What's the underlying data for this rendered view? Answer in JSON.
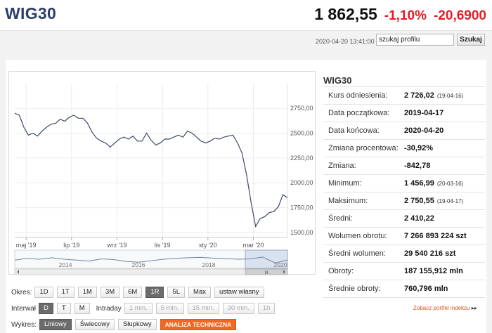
{
  "header": {
    "index_name": "WIG30",
    "value": "1 862,55",
    "change_pct": "-1,10%",
    "change_abs": "-20,6900"
  },
  "searchbar": {
    "timestamp": "2020-04-20 13:41:00",
    "search_value": "szukaj profilu",
    "search_button": "Szukaj"
  },
  "chart_data": {
    "type": "line",
    "title": "",
    "y_ticks": [
      "2750,00",
      "2500,00",
      "2250,00",
      "2000,00",
      "1750,00",
      "1500,00"
    ],
    "y_tick_values": [
      2750,
      2500,
      2250,
      2000,
      1750,
      1500
    ],
    "ylim": [
      1450,
      2850
    ],
    "x_ticks": [
      "maj '19",
      "lip '19",
      "wrz '19",
      "lis '19",
      "sty '20",
      "mar '20"
    ],
    "x_tick_positions": [
      0.5,
      2.5,
      4.5,
      6.5,
      8.5,
      10.5
    ],
    "xlim": [
      0,
      12
    ],
    "grid": true,
    "series": [
      {
        "x": [
          0,
          0.2,
          0.4,
          0.6,
          0.8,
          1.0,
          1.2,
          1.4,
          1.6,
          1.8,
          2.0,
          2.2,
          2.4,
          2.6,
          2.8,
          3.0,
          3.2,
          3.4,
          3.6,
          3.8,
          4.0,
          4.2,
          4.4,
          4.6,
          4.8,
          5.0,
          5.2,
          5.4,
          5.6,
          5.8,
          6.0,
          6.2,
          6.4,
          6.6,
          6.8,
          7.0,
          7.2,
          7.4,
          7.6,
          7.8,
          8.0,
          8.2,
          8.4,
          8.6,
          8.8,
          9.0,
          9.2,
          9.4,
          9.6,
          9.8,
          10.0,
          10.2,
          10.4,
          10.6,
          10.8,
          11.0,
          11.2,
          11.4,
          11.6,
          11.8,
          12.0
        ],
        "values": [
          2700,
          2680,
          2560,
          2480,
          2500,
          2470,
          2520,
          2560,
          2590,
          2600,
          2640,
          2620,
          2660,
          2680,
          2650,
          2650,
          2600,
          2510,
          2450,
          2420,
          2400,
          2360,
          2400,
          2440,
          2460,
          2440,
          2470,
          2420,
          2420,
          2500,
          2430,
          2380,
          2400,
          2440,
          2440,
          2460,
          2480,
          2460,
          2520,
          2500,
          2460,
          2420,
          2400,
          2420,
          2450,
          2440,
          2460,
          2470,
          2480,
          2400,
          2300,
          2080,
          1800,
          1560,
          1640,
          1660,
          1700,
          1710,
          1760,
          1880,
          1850
        ]
      }
    ]
  },
  "navigator": {
    "years": [
      "2014",
      "2016",
      "2018",
      "2020"
    ],
    "scroll_thumb": "III"
  },
  "controls": {
    "okres_label": "Okres:",
    "okres_buttons": [
      "1D",
      "1T",
      "1M",
      "3M",
      "6M",
      "1R",
      "5L",
      "Max",
      "ustaw własny"
    ],
    "interwal_label": "Interwał",
    "interwal_buttons": [
      "D",
      "T",
      "M"
    ],
    "intraday_label": "Intraday",
    "intraday_buttons": [
      "1 min.",
      "5 min.",
      "15 min.",
      "30 min.",
      "1h"
    ],
    "wykres_label": "Wykres:",
    "wykres_buttons": [
      "Liniowy",
      "Świecowy",
      "Słupkowy"
    ],
    "analiza_button": "ANALIZA TECHNICZNA"
  },
  "info": {
    "title": "WIG30",
    "rows": [
      {
        "label": "Kurs odniesienia:",
        "value": "2 726,02",
        "date": "(19-04-16)"
      },
      {
        "label": "Data początkowa:",
        "value": "2019-04-17",
        "date": ""
      },
      {
        "label": "Data końcowa:",
        "value": "2020-04-20",
        "date": ""
      },
      {
        "label": "Zmiana procentowa:",
        "value": "-30,92%",
        "date": ""
      },
      {
        "label": "Zmiana:",
        "value": "-842,78",
        "date": ""
      },
      {
        "label": "Minimum:",
        "value": "1 456,99",
        "date": "(20-03-16)"
      },
      {
        "label": "Maksimum:",
        "value": "2 750,55",
        "date": "(19-04-17)"
      },
      {
        "label": "Średni:",
        "value": "2 410,22",
        "date": ""
      },
      {
        "label": "Wolumen obrotu:",
        "value": "7 266 893 224 szt",
        "date": ""
      },
      {
        "label": "Średni wolumen:",
        "value": "29 540 216 szt",
        "date": ""
      },
      {
        "label": "Obroty:",
        "value": "187 155,912 mln",
        "date": ""
      },
      {
        "label": "Średnie obroty:",
        "value": "760,796 mln",
        "date": ""
      }
    ],
    "portfel_link": "Zobacz portfel indeksu"
  },
  "colors": {
    "title_blue": "#2c3f6b",
    "negative_red": "#e31e24",
    "accent_orange": "#f26722",
    "line": "#3c4a66"
  }
}
